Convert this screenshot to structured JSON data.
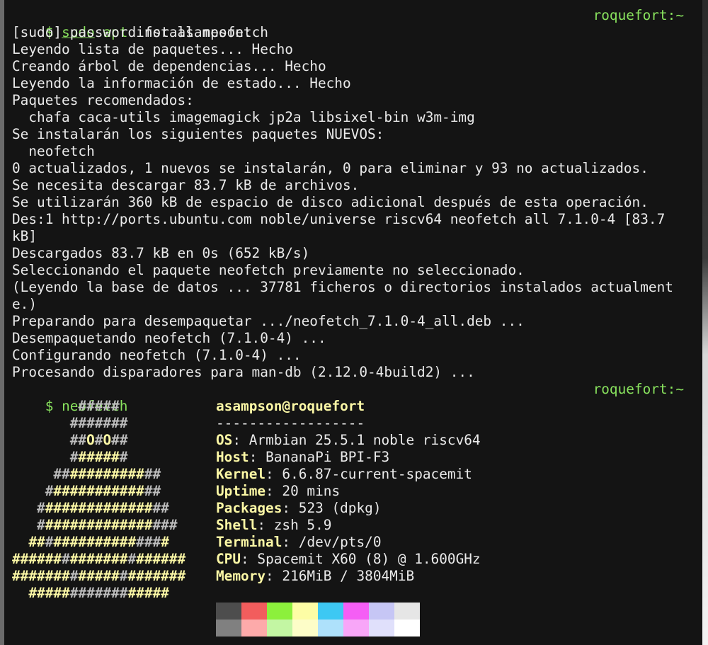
{
  "terminal": {
    "hostname": "roquefort:~",
    "prompt1": {
      "symbol": "$ ",
      "cmd1": "sudo",
      "sp1": " ",
      "cmd2": "apt",
      "rest": " install neofetch"
    },
    "output": [
      "[sudo] password for asampson:",
      "Leyendo lista de paquetes... Hecho",
      "Creando árbol de dependencias... Hecho",
      "Leyendo la información de estado... Hecho",
      "Paquetes recomendados:",
      "  chafa caca-utils imagemagick jp2a libsixel-bin w3m-img",
      "Se instalarán los siguientes paquetes NUEVOS:",
      "  neofetch",
      "0 actualizados, 1 nuevos se instalarán, 0 para eliminar y 93 no actualizados.",
      "Se necesita descargar 83.7 kB de archivos.",
      "Se utilizarán 360 kB de espacio de disco adicional después de esta operación.",
      "Des:1 http://ports.ubuntu.com noble/universe riscv64 neofetch all 7.1.0-4 [83.7",
      "kB]",
      "Descargados 83.7 kB en 0s (652 kB/s)",
      "Seleccionando el paquete neofetch previamente no seleccionado.",
      "(Leyendo la base de datos ... 37781 ficheros o directorios instalados actualment",
      "e.)",
      "Preparando para desempaquetar .../neofetch_7.1.0-4_all.deb ...",
      "Desempaquetando neofetch (7.1.0-4) ...",
      "Configurando neofetch (7.1.0-4) ...",
      "Procesando disparadores para man-db (2.12.0-4build2) ..."
    ],
    "prompt2": {
      "symbol": "$ ",
      "cmd": "neofetch"
    },
    "logo": [
      [
        {
          "t": "        ",
          "c": "none"
        },
        {
          "t": "#####",
          "c": "gry"
        }
      ],
      [
        {
          "t": "       ",
          "c": "none"
        },
        {
          "t": "#######",
          "c": "gry"
        }
      ],
      [
        {
          "t": "       ",
          "c": "none"
        },
        {
          "t": "##",
          "c": "gry"
        },
        {
          "t": "O",
          "c": "yel"
        },
        {
          "t": "#",
          "c": "gry"
        },
        {
          "t": "O",
          "c": "yel"
        },
        {
          "t": "##",
          "c": "gry"
        }
      ],
      [
        {
          "t": "       ",
          "c": "none"
        },
        {
          "t": "#",
          "c": "gry"
        },
        {
          "t": "#####",
          "c": "yel"
        },
        {
          "t": "#",
          "c": "gry"
        }
      ],
      [
        {
          "t": "     ",
          "c": "none"
        },
        {
          "t": "##",
          "c": "gry"
        },
        {
          "t": "#########",
          "c": "yel"
        },
        {
          "t": "##",
          "c": "gry"
        }
      ],
      [
        {
          "t": "    ",
          "c": "none"
        },
        {
          "t": "#",
          "c": "gry"
        },
        {
          "t": "###########",
          "c": "yel"
        },
        {
          "t": "##",
          "c": "gry"
        }
      ],
      [
        {
          "t": "   ",
          "c": "none"
        },
        {
          "t": "#",
          "c": "gry"
        },
        {
          "t": "#############",
          "c": "yel"
        },
        {
          "t": "##",
          "c": "gry"
        }
      ],
      [
        {
          "t": "   ",
          "c": "none"
        },
        {
          "t": "#",
          "c": "gry"
        },
        {
          "t": "#############",
          "c": "yel"
        },
        {
          "t": "###",
          "c": "gry"
        }
      ],
      [
        {
          "t": "  ",
          "c": "none"
        },
        {
          "t": "##",
          "c": "yel"
        },
        {
          "t": "#",
          "c": "gry"
        },
        {
          "t": "##########",
          "c": "yel"
        },
        {
          "t": "###",
          "c": "gry"
        },
        {
          "t": "#",
          "c": "yel"
        }
      ],
      [
        {
          "t": "######",
          "c": "yel"
        },
        {
          "t": "#",
          "c": "gry"
        },
        {
          "t": "#######",
          "c": "yel"
        },
        {
          "t": "#",
          "c": "gry"
        },
        {
          "t": "######",
          "c": "yel"
        }
      ],
      [
        {
          "t": "#######",
          "c": "yel"
        },
        {
          "t": "#",
          "c": "gry"
        },
        {
          "t": "#####",
          "c": "yel"
        },
        {
          "t": "#",
          "c": "gry"
        },
        {
          "t": "#######",
          "c": "yel"
        }
      ],
      [
        {
          "t": "  ",
          "c": "none"
        },
        {
          "t": "#####",
          "c": "yel"
        },
        {
          "t": "#######",
          "c": "gry"
        },
        {
          "t": "#####",
          "c": "yel"
        }
      ]
    ],
    "sysinfo": {
      "user_host": "asampson@roquefort",
      "separator": "------------------",
      "fields": [
        {
          "key": "OS",
          "value": "Armbian 25.5.1 noble riscv64"
        },
        {
          "key": "Host",
          "value": "BananaPi BPI-F3"
        },
        {
          "key": "Kernel",
          "value": "6.6.87-current-spacemit"
        },
        {
          "key": "Uptime",
          "value": "20 mins"
        },
        {
          "key": "Packages",
          "value": "523 (dpkg)"
        },
        {
          "key": "Shell",
          "value": "zsh 5.9"
        },
        {
          "key": "Terminal",
          "value": "/dev/pts/0"
        },
        {
          "key": "CPU",
          "value": "Spacemit X60 (8) @ 1.600GHz"
        },
        {
          "key": "Memory",
          "value": "216MiB / 3804MiB"
        }
      ]
    },
    "palette": {
      "normal": [
        "#4d4d4d",
        "#f25d5d",
        "#8cf03c",
        "#fdfda5",
        "#3dc8f3",
        "#f55ef5",
        "#c6c6f5",
        "#e6e6e6"
      ],
      "bright": [
        "#808080",
        "#fdaaaa",
        "#c3f6a3",
        "#fdfdc8",
        "#aee1fb",
        "#f8a6f8",
        "#e0e0fb",
        "#ffffff"
      ]
    }
  }
}
